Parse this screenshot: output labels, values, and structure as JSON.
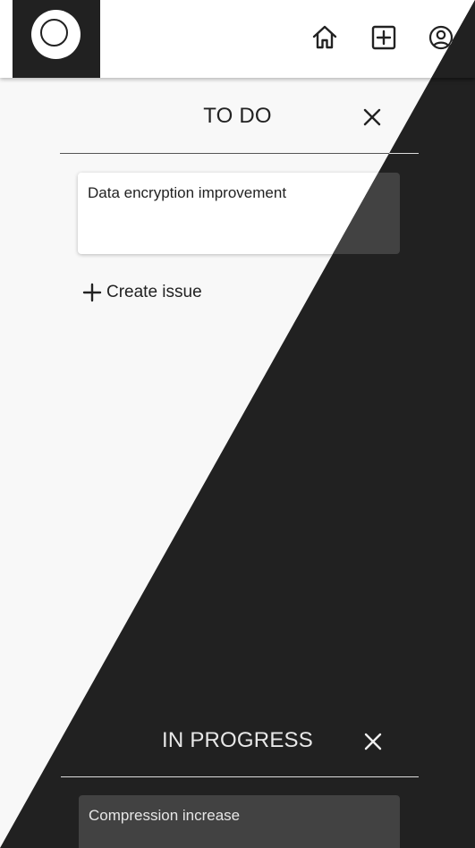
{
  "header": {
    "logo_icon": "circle-logo-icon",
    "nav_icons": [
      "home-icon",
      "add-box-icon",
      "account-circle-icon"
    ]
  },
  "board": {
    "columns": [
      {
        "title": "TO DO",
        "close_icon": "close-icon",
        "cards": [
          "Data encryption improvement"
        ],
        "create_label": "Create issue",
        "create_icon": "plus-icon"
      },
      {
        "title": "IN PROGRESS",
        "close_icon": "close-icon",
        "cards": [
          "Compression increase"
        ]
      }
    ]
  },
  "theme": {
    "light_background": "#f8f8f8",
    "dark_background": "#212121",
    "dark_card": "#424242"
  }
}
